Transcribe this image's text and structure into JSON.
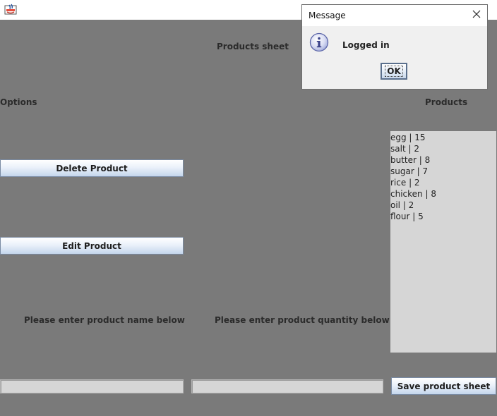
{
  "window": {
    "icon": "java-app-icon"
  },
  "main": {
    "title": "Products sheet",
    "options_label": "Options",
    "products_label": "Products",
    "delete_button": "Delete Product",
    "edit_button": "Edit Product",
    "name_prompt": "Please enter product name below",
    "quantity_prompt": "Please enter product quantity below",
    "name_input_value": "",
    "quantity_input_value": "",
    "save_button": "Save product sheet",
    "products": [
      "egg | 15",
      "salt | 2",
      "butter | 8",
      "sugar | 7",
      "rice | 2",
      "chicken | 8",
      "oil | 2",
      "flour | 5"
    ]
  },
  "dialog": {
    "title": "Message",
    "message": "Logged in",
    "ok_button": "OK",
    "icon": "info-icon",
    "close_icon": "close-icon"
  },
  "colors": {
    "background": "#7a7a7a",
    "list_background": "#d6d6d6",
    "dialog_background": "#f0f0f0"
  }
}
